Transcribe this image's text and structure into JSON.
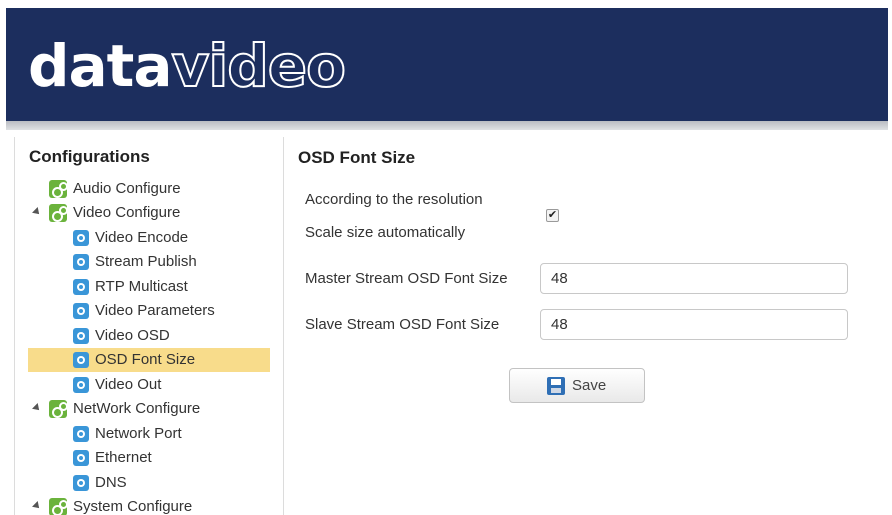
{
  "header": {
    "logo_bold": "data",
    "logo_outline": "video",
    "bg_color": "#1c2e5e"
  },
  "sidebar": {
    "title": "Configurations",
    "items": [
      {
        "label": "Audio Configure",
        "level": 0,
        "icon": "green-gear-icon"
      },
      {
        "label": "Video Configure",
        "level": 0,
        "icon": "green-gear-icon",
        "expanded": true
      },
      {
        "label": "Video Encode",
        "level": 1,
        "icon": "blue-gear-icon"
      },
      {
        "label": "Stream Publish",
        "level": 1,
        "icon": "blue-gear-icon"
      },
      {
        "label": "RTP Multicast",
        "level": 1,
        "icon": "blue-gear-icon"
      },
      {
        "label": "Video Parameters",
        "level": 1,
        "icon": "blue-gear-icon"
      },
      {
        "label": "Video OSD",
        "level": 1,
        "icon": "blue-gear-icon"
      },
      {
        "label": "OSD Font Size",
        "level": 1,
        "icon": "blue-gear-icon",
        "selected": true
      },
      {
        "label": "Video Out",
        "level": 1,
        "icon": "blue-gear-icon"
      },
      {
        "label": "NetWork Configure",
        "level": 0,
        "icon": "green-gear-icon",
        "expanded": true
      },
      {
        "label": "Network Port",
        "level": 1,
        "icon": "blue-gear-icon"
      },
      {
        "label": "Ethernet",
        "level": 1,
        "icon": "blue-gear-icon"
      },
      {
        "label": "DNS",
        "level": 1,
        "icon": "blue-gear-icon"
      },
      {
        "label": "System Configure",
        "level": 0,
        "icon": "green-gear-icon",
        "expanded": true
      }
    ],
    "selected_color": "#f8dc8b"
  },
  "main": {
    "title": "OSD Font Size",
    "auto_scale_line1": "According to the resolution",
    "auto_scale_line2": "Scale size automatically",
    "auto_scale_checked": true,
    "checkmark": "✔",
    "master_label": "Master Stream OSD Font Size",
    "master_value": "48",
    "slave_label": "Slave Stream OSD Font Size",
    "slave_value": "48",
    "save_label": "Save"
  }
}
